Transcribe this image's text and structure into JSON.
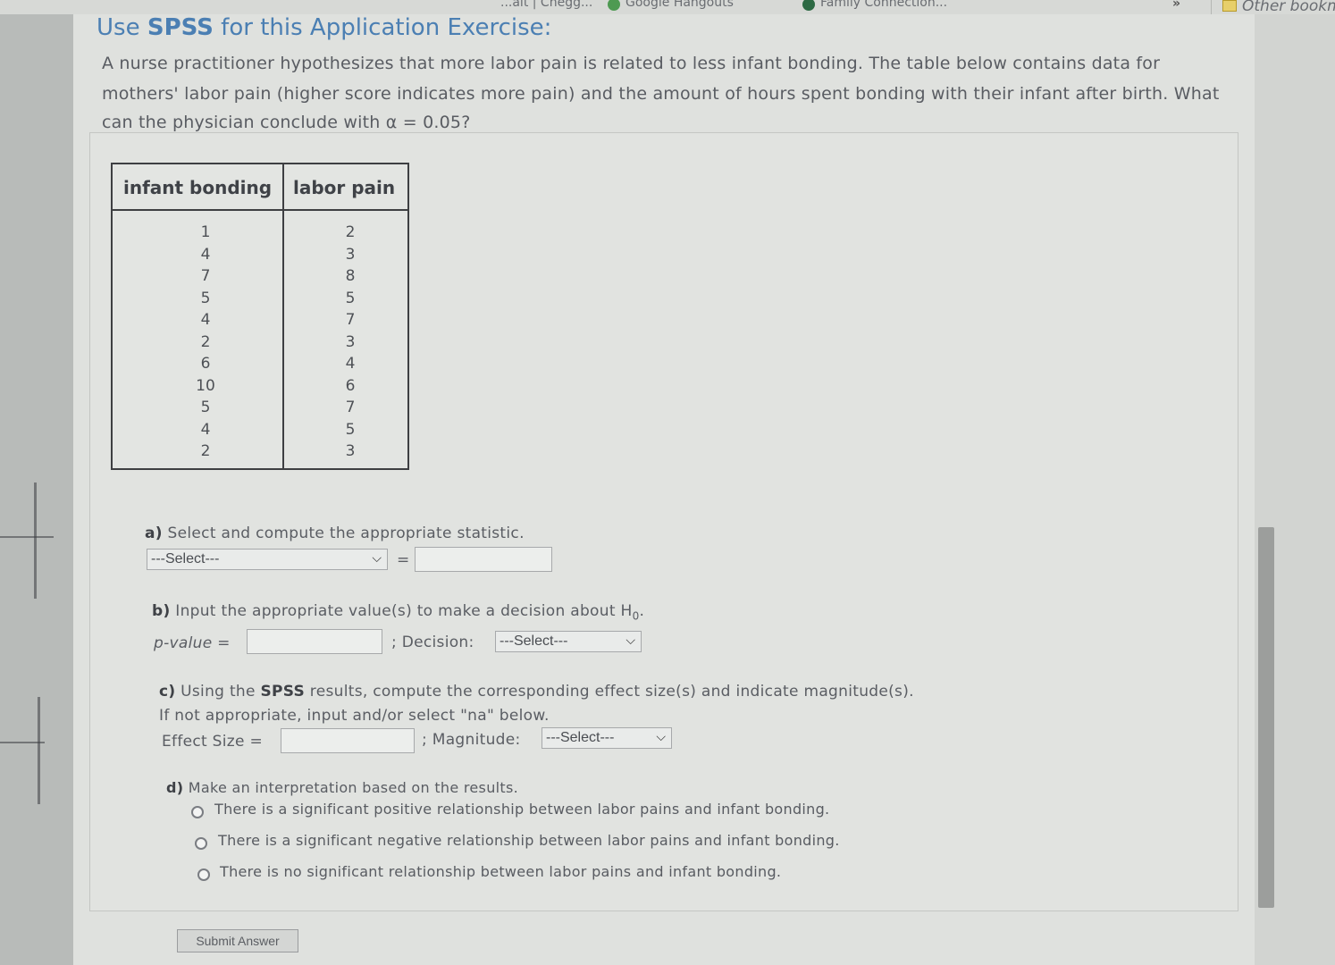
{
  "bookmarks": {
    "item1": "...alt | Chegg...",
    "item2": "Google Hangouts",
    "item3": "Family Connection...",
    "overflow": "»",
    "other": "Other bookm"
  },
  "title_prefix": "Use ",
  "title_bold": "SPSS",
  "title_suffix": " for this Application Exercise:",
  "question": {
    "line1": "A nurse practitioner hypothesizes that more labor pain is related to less infant bonding.  The table below contains data for",
    "line2": "mothers' labor pain (higher score indicates more pain) and the amount of hours spent bonding with their infant after birth.  What",
    "line3": "can the physician conclude with α = 0.05?"
  },
  "table": {
    "headers": [
      "infant bonding",
      "labor pain"
    ],
    "col1": [
      "1",
      "4",
      "7",
      "5",
      "4",
      "2",
      "6",
      "10",
      "5",
      "4",
      "2"
    ],
    "col2": [
      "2",
      "3",
      "8",
      "5",
      "7",
      "3",
      "4",
      "6",
      "7",
      "5",
      "3"
    ]
  },
  "part_a": {
    "letter": "a)",
    "text": " Select and compute the appropriate statistic.",
    "select": "---Select---",
    "equals": "="
  },
  "part_b": {
    "letter": "b)",
    "text": " Input the appropriate value(s) to make a decision about H",
    "sub": "0",
    "end": ".",
    "pvalue_label": "p-value =",
    "decision_label": "; Decision:",
    "decision_select": "---Select---"
  },
  "part_c": {
    "letter": "c)",
    "text1": " Using the ",
    "text_bold": "SPSS",
    "text2": " results, compute the corresponding effect size(s) and indicate magnitude(s).",
    "line2": "If not appropriate, input and/or select \"na\" below.",
    "effect_label": "Effect Size =",
    "magnitude_label": "; Magnitude:",
    "magnitude_select": "---Select---"
  },
  "part_d": {
    "letter": "d)",
    "text": " Make an interpretation based on the results.",
    "options": [
      "There is a significant positive relationship between labor pains and infant bonding.",
      "There is a significant negative relationship between labor pains and infant bonding.",
      "There is no significant relationship between labor pains and infant bonding."
    ]
  },
  "submit": "Submit Answer"
}
